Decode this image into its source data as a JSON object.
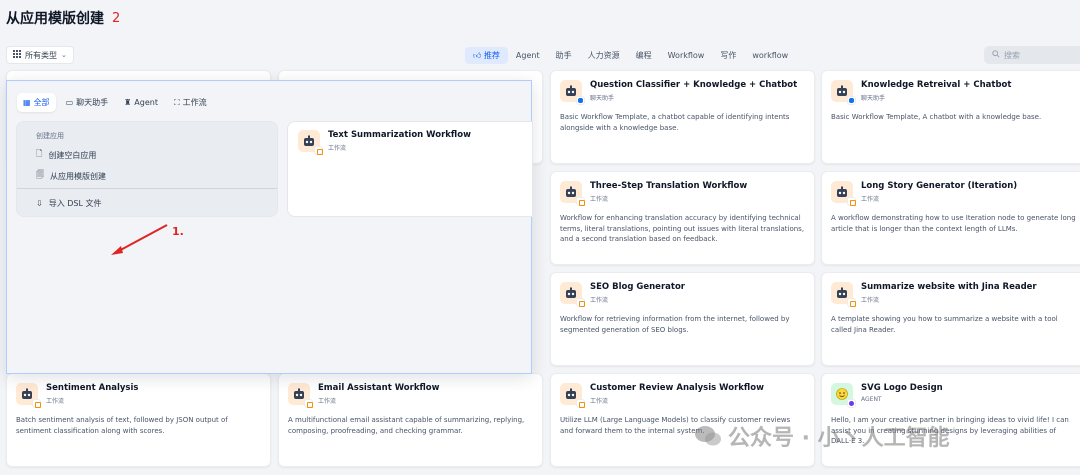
{
  "header": {
    "title": "从应用模版创建",
    "annotation_number": "2"
  },
  "toolbar": {
    "type_filter": "所有类型",
    "tabs": [
      "推荐",
      "Agent",
      "助手",
      "人力资源",
      "编程",
      "Workflow",
      "写作",
      "workflow"
    ],
    "search_placeholder": "搜索"
  },
  "overlay": {
    "tabs": [
      "全部",
      "聊天助手",
      "Agent",
      "工作流"
    ],
    "menu_label": "创建应用",
    "menu_items": [
      "创建空白应用",
      "从应用模版创建",
      "导入 DSL 文件"
    ],
    "annotation": "1.",
    "preview_card": {
      "title": "Text Summarization Workflow",
      "type": "工作流"
    }
  },
  "cards": [
    {
      "title": "Question Classifier + Knowledge + Chatbot",
      "type": "聊天助手",
      "desc": "Basic Workflow Template, a chatbot capable of identifying intents alongside with a knowledge base."
    },
    {
      "title": "Knowledge Retreival + Chatbot",
      "type": "聊天助手",
      "desc": "Basic Workflow Template, A chatbot with a knowledge base."
    },
    {
      "title": "Three-Step Translation Workflow",
      "type": "工作流",
      "desc": "Workflow for enhancing translation accuracy by identifying technical terms, literal translations, pointing out issues with literal translations, and a second translation based on feedback."
    },
    {
      "title": "Long Story Generator (Iteration)",
      "type": "工作流",
      "desc": "A workflow demonstrating how to use Iteration node to generate long article that is longer than the context length of LLMs."
    },
    {
      "title": "SEO Blog Generator",
      "type": "工作流",
      "desc": "Workflow for retrieving information from the internet, followed by segmented generation of SEO blogs."
    },
    {
      "title": "Summarize website with Jina Reader",
      "type": "工作流",
      "desc": "A template showing you how to summarize a website with a tool called Jina Reader."
    },
    {
      "title": "Sentiment Analysis",
      "type": "工作流",
      "desc": "Batch sentiment analysis of text, followed by JSON output of sentiment classification along with scores."
    },
    {
      "title": "Email Assistant Workflow",
      "type": "工作流",
      "desc": "A multifunctional email assistant capable of summarizing, replying, composing, proofreading, and checking grammar."
    },
    {
      "title": "Customer Review Analysis Workflow",
      "type": "工作流",
      "desc": "Utilize LLM (Large Language Models) to classify customer reviews and forward them to the internal system."
    },
    {
      "title": "SVG Logo Design",
      "type": "AGENT",
      "desc": "Hello, I am your creative partner in bringing ideas to vivid life! I can assist you in creating stunning designs by leveraging abilities of DALL·E 3."
    }
  ],
  "watermark": "公众号 · 小丶人工智能",
  "colors": {
    "accent": "#155eef",
    "annotation": "#e02424",
    "icon_bg": "#ffead5"
  }
}
